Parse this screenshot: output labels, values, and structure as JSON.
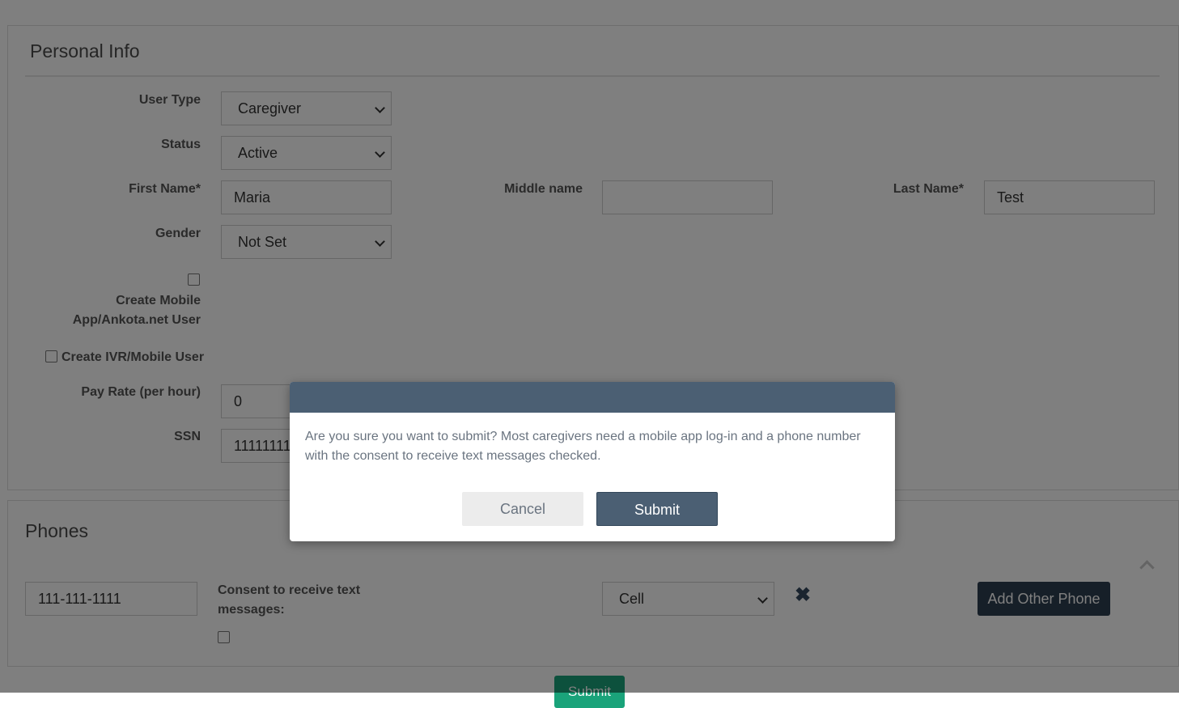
{
  "personal": {
    "title": "Personal Info",
    "user_type_label": "User Type",
    "user_type_value": "Caregiver",
    "status_label": "Status",
    "status_value": "Active",
    "first_name_label": "First Name*",
    "first_name_value": "Maria",
    "middle_name_label": "Middle name",
    "middle_name_value": "",
    "last_name_label": "Last Name*",
    "last_name_value": "Test",
    "gender_label": "Gender",
    "gender_value": "Not Set",
    "create_mobile_label_line1": "Create Mobile",
    "create_mobile_label_line2": "App/Ankota.net User",
    "create_ivr_label": "Create IVR/Mobile User",
    "pay_rate_label": "Pay Rate (per hour)",
    "pay_rate_value": "0",
    "ssn_label": "SSN",
    "ssn_value": "111111111"
  },
  "phones": {
    "title": "Phones",
    "phone_value": "111-111-1111",
    "consent_label_line1": "Consent to receive text",
    "consent_label_line2": "messages:",
    "phone_type_value": "Cell",
    "add_other_phone_label": "Add Other Phone",
    "remove_icon": "close-icon",
    "collapse_icon": "chevron-up-icon"
  },
  "page_submit_label": "Submit",
  "modal": {
    "message": "Are you sure you want to submit? Most caregivers need a mobile app log-in and a phone number with the consent to receive text messages checked.",
    "cancel_label": "Cancel",
    "submit_label": "Submit"
  },
  "colors": {
    "modal_header": "#4b5f73",
    "dark_button": "#2c3e50",
    "page_submit": "#1aa37a"
  }
}
